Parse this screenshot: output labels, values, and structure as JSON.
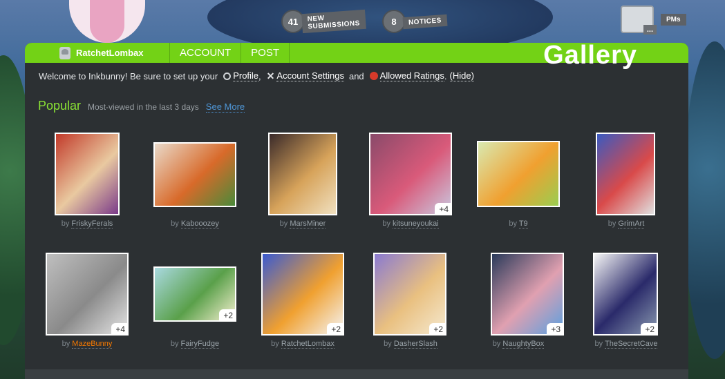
{
  "notices": {
    "submissions_count": "41",
    "submissions_label_1": "NEW",
    "submissions_label_2": "SUBMISSIONS",
    "notices_count": "8",
    "notices_label": "NOTICES",
    "pm_count": "...",
    "pm_label": "PMs"
  },
  "topbar": {
    "username": "RatchetLombax",
    "account": "ACCOUNT",
    "post": "POST",
    "page_title": "Gallery"
  },
  "welcome": {
    "text_1": "Welcome to Inkbunny! Be sure to set up your",
    "profile": "Profile",
    "comma": ",",
    "account_settings": "Account Settings",
    "and": "and",
    "allowed_ratings": "Allowed Ratings",
    "period": ".",
    "hide": "(Hide)"
  },
  "popular": {
    "title": "Popular",
    "subtitle": "Most-viewed in the last 3 days",
    "see_more": "See More"
  },
  "submissions": [
    {
      "by": "by",
      "artist": "FriskyFerals",
      "extra": "",
      "colors": [
        "#c23a2a",
        "#e9c9a0",
        "#7a3a8a"
      ]
    },
    {
      "by": "by",
      "artist": "Kabooozey",
      "extra": "",
      "colors": [
        "#e9d9c9",
        "#d86a2a",
        "#4a8a3a"
      ]
    },
    {
      "by": "by",
      "artist": "MarsMiner",
      "extra": "",
      "colors": [
        "#3a2a2a",
        "#d7a35a",
        "#f0e0c0"
      ]
    },
    {
      "by": "by",
      "artist": "kitsuneyoukai",
      "extra": "+4",
      "colors": [
        "#8a4a6a",
        "#d95a7a",
        "#c9c9e0"
      ]
    },
    {
      "by": "by",
      "artist": "T9",
      "extra": "",
      "colors": [
        "#d9e9b0",
        "#f0a030",
        "#9acd50"
      ]
    },
    {
      "by": "by",
      "artist": "GrimArt",
      "extra": "",
      "colors": [
        "#3a5ac0",
        "#d94a4a",
        "#e0e0e0"
      ]
    },
    {
      "by": "by",
      "artist": "MazeBunny",
      "extra": "+4",
      "colors": [
        "#bfbfbf",
        "#8a8a8a",
        "#e5e5e5"
      ]
    },
    {
      "by": "by",
      "artist": "FairyFudge",
      "extra": "+2",
      "colors": [
        "#a9d9e0",
        "#5aa04a",
        "#f5f0d0"
      ]
    },
    {
      "by": "by",
      "artist": "RatchetLombax",
      "extra": "+2",
      "colors": [
        "#3a5ad0",
        "#f0a030",
        "#f5f5f5"
      ]
    },
    {
      "by": "by",
      "artist": "DasherSlash",
      "extra": "+2",
      "colors": [
        "#8a7ad0",
        "#e9c080",
        "#f5e9d0"
      ]
    },
    {
      "by": "by",
      "artist": "NaughtyBox",
      "extra": "+3",
      "colors": [
        "#2a3a5a",
        "#e0a0b0",
        "#5aa0e0"
      ]
    },
    {
      "by": "by",
      "artist": "TheSecretCave",
      "extra": "+2",
      "colors": [
        "#f5f5f5",
        "#2a2a6a",
        "#8a9ab0"
      ]
    }
  ]
}
